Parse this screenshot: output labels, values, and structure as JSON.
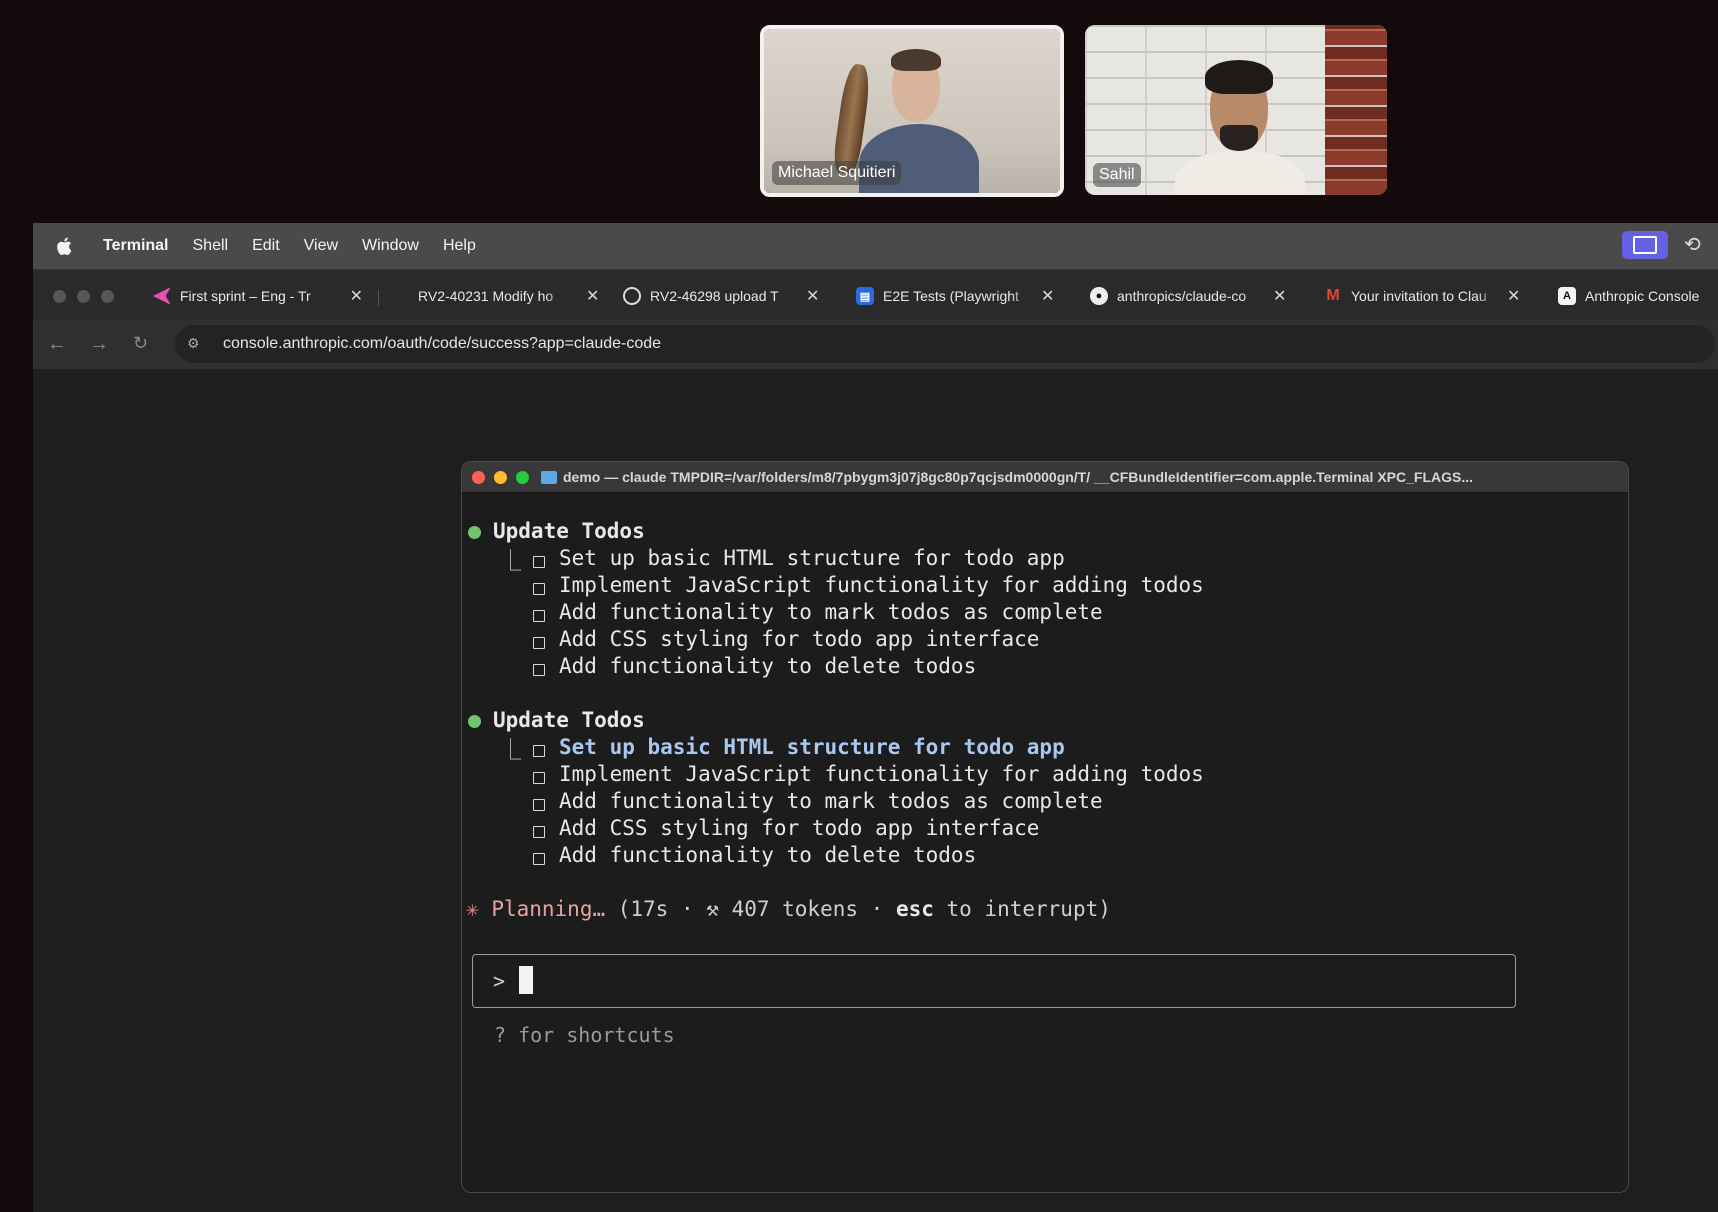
{
  "participants": [
    {
      "name": "Michael Squitieri"
    },
    {
      "name": "Sahil"
    }
  ],
  "menubar": {
    "app": "Terminal",
    "items": [
      "Shell",
      "Edit",
      "View",
      "Window",
      "Help"
    ]
  },
  "tabs": [
    {
      "title": "First sprint – Eng - Tr",
      "icon": "clickup-icon",
      "color": "#e84fb0"
    },
    {
      "title": "RV2-40231 Modify ho",
      "icon": "none",
      "color": "#2a2a2a"
    },
    {
      "title": "RV2-46298 upload T",
      "icon": "github-x-icon",
      "color": "#2a2a2a"
    },
    {
      "title": "E2E Tests (Playwright",
      "icon": "document-icon",
      "color": "#2d6bd8"
    },
    {
      "title": "anthropics/claude-co",
      "icon": "github-icon",
      "color": "#2a2a2a"
    },
    {
      "title": "Your invitation to Clau",
      "icon": "gmail-icon",
      "color": "#2a2a2a"
    },
    {
      "title": "Anthropic Console",
      "icon": "anthropic-icon",
      "color": "#2a2a2a"
    }
  ],
  "address_bar": {
    "url": "console.anthropic.com/oauth/code/success?app=claude-code"
  },
  "terminal": {
    "title": "demo — claude TMPDIR=/var/folders/m8/7pbygm3j07j8gc80p7qcjsdm0000gn/T/ __CFBundleIdentifier=com.apple.Terminal XPC_FLAGS...",
    "blocks": [
      {
        "heading": "Update Todos",
        "items": [
          "Set up basic HTML structure for todo app",
          "Implement JavaScript functionality for adding todos",
          "Add functionality to mark todos as complete",
          "Add CSS styling for todo app interface",
          "Add functionality to delete todos"
        ]
      },
      {
        "heading": "Update Todos",
        "items": [
          "Set up basic HTML structure for todo app",
          "Implement JavaScript functionality for adding todos",
          "Add functionality to mark todos as complete",
          "Add CSS styling for todo app interface",
          "Add functionality to delete todos"
        ]
      }
    ],
    "status": {
      "spinner": "✳",
      "label": "Planning…",
      "open": " (17s · ",
      "tool_icon": "⚒",
      "tokens": " 407 tokens · ",
      "key": "esc",
      "tail": " to interrupt)"
    },
    "prompt": ">",
    "hint": "? for shortcuts"
  }
}
